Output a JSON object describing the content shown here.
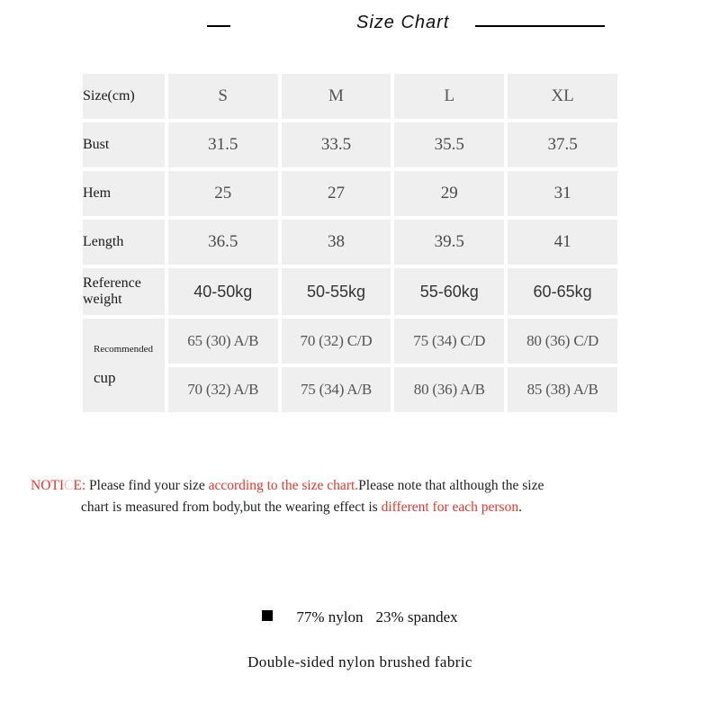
{
  "title": {
    "text": "Size Chart"
  },
  "table": {
    "columns": [
      "Size(cm)",
      "S",
      "M",
      "L",
      "XL"
    ],
    "rows": [
      {
        "label": "Bust",
        "values": [
          "31.5",
          "33.5",
          "35.5",
          "37.5"
        ]
      },
      {
        "label": "Hem",
        "values": [
          "25",
          "27",
          "29",
          "31"
        ]
      },
      {
        "label": "Length",
        "values": [
          "36.5",
          "38",
          "39.5",
          "41"
        ]
      },
      {
        "label": "Reference weight",
        "label_line1": "Reference",
        "label_line2": "weight",
        "values": [
          "40-50kg",
          "50-55kg",
          "55-60kg",
          "60-65kg"
        ]
      }
    ],
    "cup_section": {
      "label_small": "Recommended",
      "label_big": "cup",
      "rows": [
        {
          "values": [
            "65 (30) A/B",
            "70 (32) C/D",
            "75 (34) C/D",
            "80 (36) C/D"
          ]
        },
        {
          "values": [
            "70 (32) A/B",
            "75 (34) A/B",
            "80 (36) A/B",
            "85 (38) A/B"
          ]
        }
      ]
    }
  },
  "notice": {
    "label_part1": "NOTI",
    "label_faint": "C",
    "label_part2": "E:",
    "text1": " Please find your size ",
    "highlight1": "according to the size chart.",
    "text2": "Please note that although the size",
    "line2_text": "chart is measured from body,but the wearing effect is ",
    "highlight2": "different for each person",
    "period": "."
  },
  "fabric": {
    "composition_nylon": "77% nylon",
    "composition_spandex": "23% spandex",
    "description": "Double-sided nylon brushed fabric"
  },
  "colors": {
    "cell_background": "#efefef",
    "page_background": "#ffffff",
    "notice_red": "#e8352c",
    "text_dark": "#1a1a1a",
    "value_gray": "#4a4a4a"
  }
}
